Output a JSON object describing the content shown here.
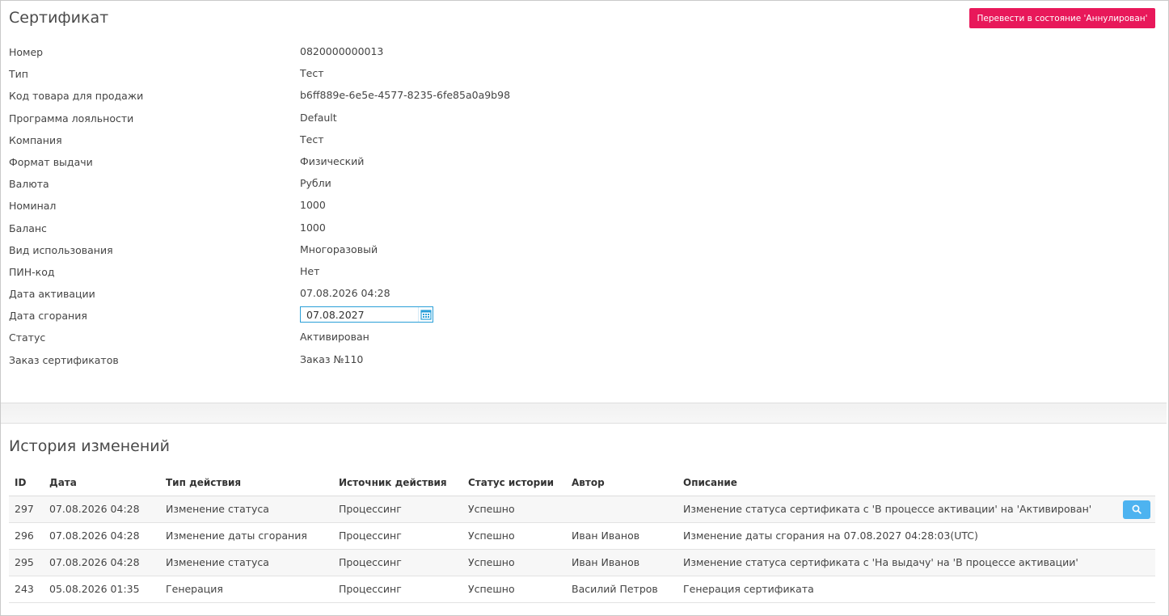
{
  "certificate": {
    "title": "Сертификат",
    "cancel_button": "Перевести в состояние 'Аннулирован'",
    "fields": [
      {
        "label": "Номер",
        "value": "0820000000013"
      },
      {
        "label": "Тип",
        "value": "Тест"
      },
      {
        "label": "Код товара для продажи",
        "value": "b6ff889e-6e5e-4577-8235-6fe85a0a9b98"
      },
      {
        "label": "Программа лояльности",
        "value": "Default"
      },
      {
        "label": "Компания",
        "value": "Тест"
      },
      {
        "label": "Формат выдачи",
        "value": "Физический"
      },
      {
        "label": "Валюта",
        "value": "Рубли"
      },
      {
        "label": "Номинал",
        "value": "1000"
      },
      {
        "label": "Баланс",
        "value": "1000"
      },
      {
        "label": "Вид использования",
        "value": "Многоразовый"
      },
      {
        "label": "ПИН-код",
        "value": "Нет"
      },
      {
        "label": "Дата активации",
        "value": "07.08.2026 04:28"
      },
      {
        "label": "Дата сгорания",
        "value": "07.08.2027"
      },
      {
        "label": "Статус",
        "value": "Активирован"
      },
      {
        "label": "Заказ сертификатов",
        "value": "Заказ №110"
      }
    ]
  },
  "history": {
    "title": "История изменений",
    "columns": [
      "ID",
      "Дата",
      "Тип действия",
      "Источник действия",
      "Статус истории",
      "Автор",
      "Описание"
    ],
    "rows": [
      {
        "id": "297",
        "date": "07.08.2026 04:28",
        "action": "Изменение статуса",
        "source": "Процессинг",
        "status": "Успешно",
        "author": "",
        "description": "Изменение статуса сертификата с 'В процессе активации' на 'Активирован'"
      },
      {
        "id": "296",
        "date": "07.08.2026 04:28",
        "action": "Изменение даты сгорания",
        "source": "Процессинг",
        "status": "Успешно",
        "author": "Иван Иванов",
        "description": "Изменение даты сгорания на 07.08.2027 04:28:03(UTC)"
      },
      {
        "id": "295",
        "date": "07.08.2026 04:28",
        "action": "Изменение статуса",
        "source": "Процессинг",
        "status": "Успешно",
        "author": "Иван Иванов",
        "description": "Изменение статуса сертификата с 'На выдачу' на 'В процессе активации'"
      },
      {
        "id": "243",
        "date": "05.08.2026 01:35",
        "action": "Генерация",
        "source": "Процессинг",
        "status": "Успешно",
        "author": "Василий Петров",
        "description": "Генерация сертификата"
      }
    ]
  },
  "icons": {
    "calendar": "calendar-icon",
    "search": "search-icon"
  },
  "colors": {
    "cancel_button": "#e8185a",
    "search_button": "#4db3f0",
    "date_input_border": "#2a9fd8"
  }
}
